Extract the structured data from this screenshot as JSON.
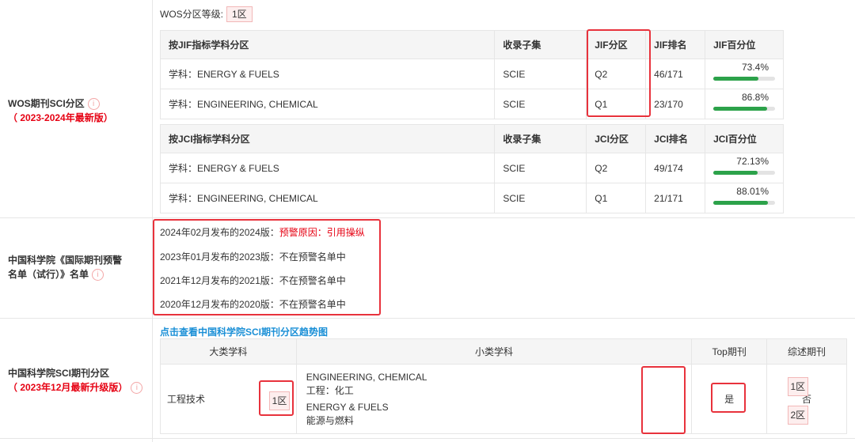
{
  "wos": {
    "grade_label": "WOS分区等级:",
    "grade_value": "1区",
    "row_label": "WOS期刊SCI分区",
    "row_sub": "（ 2023-2024年最新版）",
    "jif_table": {
      "headers": [
        "按JIF指标学科分区",
        "收录子集",
        "JIF分区",
        "JIF排名",
        "JIF百分位"
      ],
      "rows": [
        {
          "subject": "学科：ENERGY & FUELS",
          "subset": "SCIE",
          "quartile": "Q2",
          "rank": "46/171",
          "pct_text": "73.4%",
          "pct": 73.4
        },
        {
          "subject": "学科：ENGINEERING, CHEMICAL",
          "subset": "SCIE",
          "quartile": "Q1",
          "rank": "23/170",
          "pct_text": "86.8%",
          "pct": 86.8
        }
      ]
    },
    "jci_table": {
      "headers": [
        "按JCI指标学科分区",
        "收录子集",
        "JCI分区",
        "JCI排名",
        "JCI百分位"
      ],
      "rows": [
        {
          "subject": "学科：ENERGY & FUELS",
          "subset": "SCIE",
          "quartile": "Q2",
          "rank": "49/174",
          "pct_text": "72.13%",
          "pct": 72.13
        },
        {
          "subject": "学科：ENGINEERING, CHEMICAL",
          "subset": "SCIE",
          "quartile": "Q1",
          "rank": "21/171",
          "pct_text": "88.01%",
          "pct": 88.01
        }
      ]
    }
  },
  "warning": {
    "row_label_1": "中国科学院《国际期刊预警",
    "row_label_2": "名单（试行）》名单",
    "lines": [
      {
        "prefix": "2024年02月发布的2024版：",
        "status": "预警原因：引用操纵",
        "highlight": true
      },
      {
        "prefix": "2023年01月发布的2023版：",
        "status": "不在预警名单中",
        "highlight": false
      },
      {
        "prefix": "2021年12月发布的2021版：",
        "status": "不在预警名单中",
        "highlight": false
      },
      {
        "prefix": "2020年12月发布的2020版：",
        "status": "不在预警名单中",
        "highlight": false
      }
    ]
  },
  "cas": {
    "row_label": "中国科学院SCI期刊分区",
    "row_sub": "（ 2023年12月最新升级版）",
    "trend_link": "点击查看中国科学院SCI期刊分区趋势图",
    "headers": [
      "大类学科",
      "小类学科",
      "Top期刊",
      "综述期刊"
    ],
    "major": "工程技术",
    "major_zone": "1区",
    "subs": [
      {
        "en": "ENGINEERING, CHEMICAL",
        "cn": "工程：化工",
        "zone": "1区"
      },
      {
        "en": "ENERGY & FUELS",
        "cn": "能源与燃料",
        "zone": "2区"
      }
    ],
    "top": "是",
    "review": "否"
  },
  "icons": {
    "info": "info-circle-icon"
  },
  "colors": {
    "accent_red": "#e60012",
    "box_red": "#e8323c",
    "bar_green": "#2ca24a",
    "link_blue": "#1a8fd6"
  }
}
